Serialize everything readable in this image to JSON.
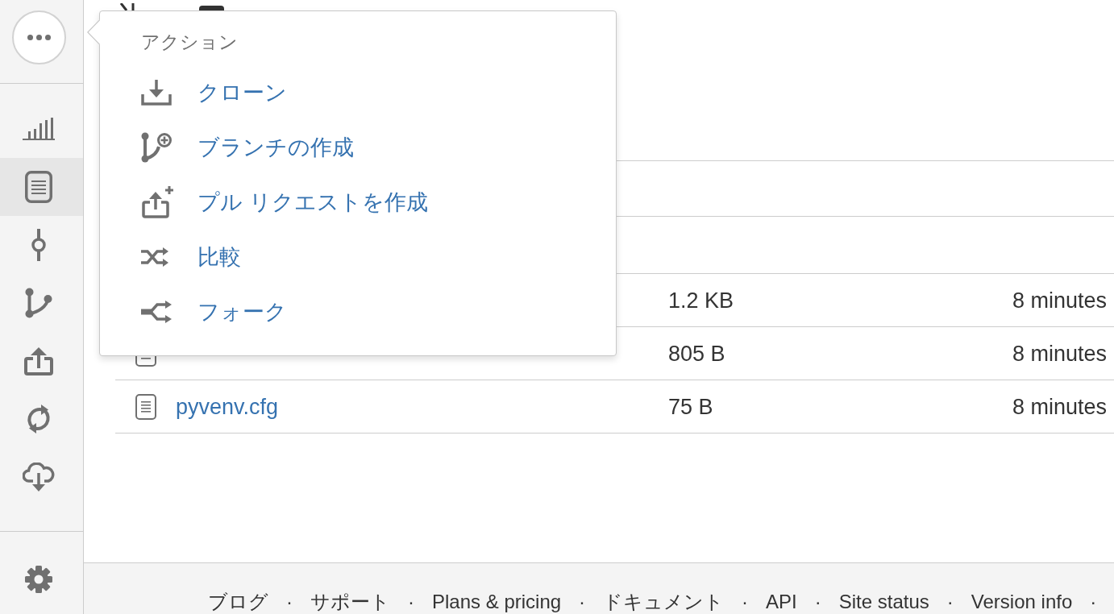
{
  "sidebar": {
    "items": [
      {
        "kind": "stats",
        "selected": false
      },
      {
        "kind": "source",
        "selected": true
      },
      {
        "kind": "commits",
        "selected": false
      },
      {
        "kind": "branches",
        "selected": false
      },
      {
        "kind": "pullrequests",
        "selected": false
      },
      {
        "kind": "sync",
        "selected": false
      },
      {
        "kind": "download",
        "selected": false
      }
    ]
  },
  "actions_menu": {
    "heading": "アクション",
    "items": [
      {
        "kind": "clone",
        "label": "クローン"
      },
      {
        "kind": "branch",
        "label": "ブランチの作成"
      },
      {
        "kind": "pullrequest",
        "label": "プル リクエストを作成"
      },
      {
        "kind": "compare",
        "label": "比較"
      },
      {
        "kind": "fork",
        "label": "フォーク"
      }
    ]
  },
  "file_table": {
    "rows": [
      {
        "size": "1.2 KB",
        "modified": "8 minutes"
      },
      {
        "kind": "file",
        "size": "805 B",
        "modified": "8 minutes"
      },
      {
        "kind": "file",
        "name": "pyvenv.cfg",
        "size": "75 B",
        "modified": "8 minutes"
      }
    ]
  },
  "footer": {
    "links": [
      {
        "label": "ブログ",
        "separator": "·"
      },
      {
        "label": "サポート",
        "separator": "·"
      },
      {
        "label": "Plans & pricing",
        "separator": "·"
      },
      {
        "label": "ドキュメント",
        "separator": "·"
      },
      {
        "label": "API",
        "separator": "·"
      },
      {
        "label": "Site status",
        "separator": "·"
      },
      {
        "label": "Version info",
        "separator": "·"
      }
    ]
  }
}
